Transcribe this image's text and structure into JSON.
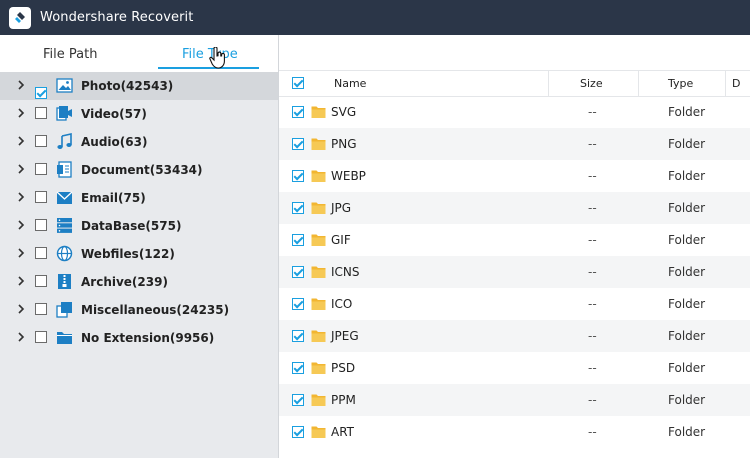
{
  "app": {
    "title": "Wondershare Recoverit"
  },
  "tabs": [
    {
      "label": "File Path"
    },
    {
      "label": "File Type"
    }
  ],
  "tree": [
    {
      "label": "Photo(42543)",
      "icon": "photo-icon",
      "checked": true,
      "selected": true
    },
    {
      "label": "Video(57)",
      "icon": "video-icon",
      "checked": false
    },
    {
      "label": "Audio(63)",
      "icon": "audio-icon",
      "checked": false
    },
    {
      "label": "Document(53434)",
      "icon": "document-icon",
      "checked": false
    },
    {
      "label": "Email(75)",
      "icon": "email-icon",
      "checked": false
    },
    {
      "label": "DataBase(575)",
      "icon": "database-icon",
      "checked": false
    },
    {
      "label": "Webfiles(122)",
      "icon": "webfiles-icon",
      "checked": false
    },
    {
      "label": "Archive(239)",
      "icon": "archive-icon",
      "checked": false
    },
    {
      "label": "Miscellaneous(24235)",
      "icon": "miscellaneous-icon",
      "checked": false
    },
    {
      "label": "No Extension(9956)",
      "icon": "folder-icon",
      "checked": false
    }
  ],
  "table": {
    "columns": {
      "name": "Name",
      "size": "Size",
      "type": "Type",
      "date": "D"
    },
    "rows": [
      {
        "name": "SVG",
        "size": "--",
        "type": "Folder"
      },
      {
        "name": "PNG",
        "size": "--",
        "type": "Folder"
      },
      {
        "name": "WEBP",
        "size": "--",
        "type": "Folder"
      },
      {
        "name": "JPG",
        "size": "--",
        "type": "Folder"
      },
      {
        "name": "GIF",
        "size": "--",
        "type": "Folder"
      },
      {
        "name": "ICNS",
        "size": "--",
        "type": "Folder"
      },
      {
        "name": "ICO",
        "size": "--",
        "type": "Folder"
      },
      {
        "name": "JPEG",
        "size": "--",
        "type": "Folder"
      },
      {
        "name": "PSD",
        "size": "--",
        "type": "Folder"
      },
      {
        "name": "PPM",
        "size": "--",
        "type": "Folder"
      },
      {
        "name": "ART",
        "size": "--",
        "type": "Folder"
      }
    ]
  },
  "colors": {
    "titlebar": "#2b3648",
    "accent": "#1a9fe0",
    "folder": "#f2b632",
    "sidebar": "#e8eaed"
  }
}
